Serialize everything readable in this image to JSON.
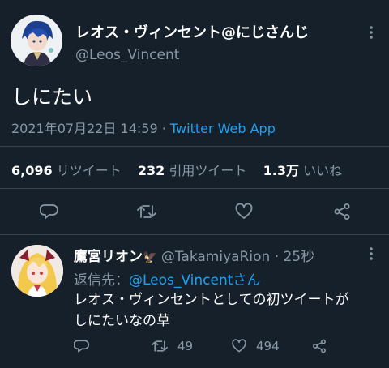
{
  "tweet": {
    "author": {
      "display_name": "レオス・ヴィンセント@にじさんじ",
      "handle": "@Leos_Vincent"
    },
    "text": "しにたい",
    "timestamp": "2021年07月22日 14:59 · ",
    "source": "Twitter Web App",
    "stats": {
      "retweets_count": "6,096",
      "retweets_label": "リツイート",
      "quotes_count": "232",
      "quotes_label": "引用ツイート",
      "likes_count": "1.3万",
      "likes_label": "いいね"
    }
  },
  "reply": {
    "author": {
      "display_name": "鷹宮リオン",
      "emoji": "🦅",
      "handle": "@TakamiyaRion",
      "time": "· 25秒"
    },
    "replying_to_prefix": "返信先：",
    "replying_to": "@Leos_Vincentさん",
    "text_line1": "レオス・ヴィンセントとしての初ツイートが",
    "text_line2": "しにたいなの草",
    "retweets": "49",
    "likes": "494"
  },
  "colors": {
    "background": "#15202b",
    "accent": "#1da1f2",
    "muted": "#8899a6",
    "divider": "#38444d"
  }
}
